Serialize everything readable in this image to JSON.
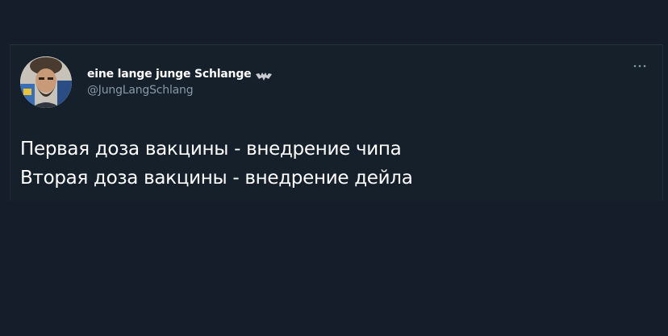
{
  "tweet": {
    "author": {
      "display_name": "eine lange junge Schlange",
      "name_emoji": "bat-emoji",
      "handle": "@JungLangSchlang",
      "avatar": "bearded-man-avatar"
    },
    "menu_icon": "more-horizontal-icon",
    "text_lines": [
      "Первая доза вакцины - внедрение чипа",
      "Вторая доза вакцины - внедрение дейла"
    ]
  },
  "colors": {
    "background": "#161d2a",
    "card": "#15202b",
    "text_primary": "#ffffff",
    "text_secondary": "#8899a6"
  }
}
